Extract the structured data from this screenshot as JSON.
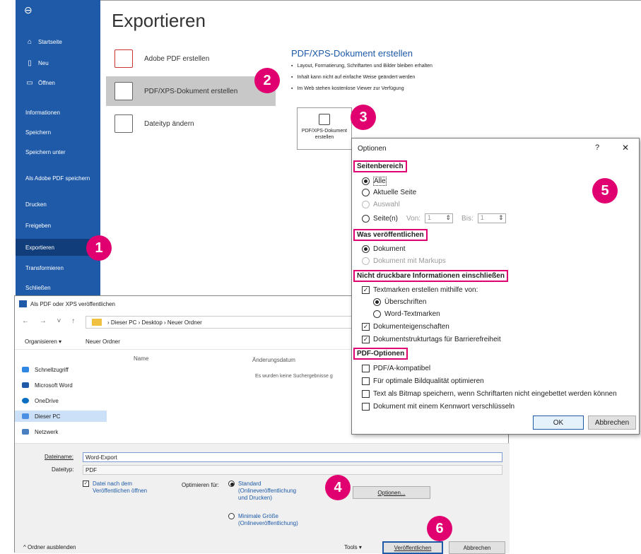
{
  "sidebar": {
    "back": "⊖",
    "items": [
      {
        "label": "Startseite",
        "icon": "home-icon"
      },
      {
        "label": "Neu",
        "icon": "new-document-icon"
      },
      {
        "label": "Öffnen",
        "icon": "open-folder-icon"
      },
      {
        "label": "Informationen"
      },
      {
        "label": "Speichern"
      },
      {
        "label": "Speichern unter"
      },
      {
        "label": "Als Adobe PDF speichern"
      },
      {
        "label": "Drucken"
      },
      {
        "label": "Freigeben"
      },
      {
        "label": "Exportieren"
      },
      {
        "label": "Transformieren"
      },
      {
        "label": "Schließen"
      }
    ]
  },
  "backstage": {
    "title": "Exportieren",
    "items": [
      "Adobe PDF erstellen",
      "PDF/XPS-Dokument erstellen",
      "Dateityp ändern"
    ],
    "pdf_heading": "PDF/XPS-Dokument erstellen",
    "bullets": [
      "Layout, Formatierung, Schriftarten und Bilder bleiben erhalten",
      "Inhalt kann nicht auf einfache Weise geändert werden",
      "Im Web stehen kostenlose Viewer zur Verfügung"
    ],
    "pdf_button": "PDF/XPS-Dokument erstellen"
  },
  "badges": [
    "1",
    "2",
    "3",
    "4",
    "5",
    "6"
  ],
  "save_dialog": {
    "title": "Als PDF oder XPS veröffentlichen",
    "path": "›  Dieser PC  ›  Desktop  ›  Neuer Ordner",
    "organize": "Organisieren ▾",
    "new_folder": "Neuer Ordner",
    "col_name": "Name",
    "col_date": "Änderungsdatum",
    "empty": "Es wurden keine Suchergebnisse g",
    "nav": [
      "Schnellzugriff",
      "Microsoft Word",
      "OneDrive",
      "Dieser PC",
      "Netzwerk"
    ],
    "filename_label": "Dateiname:",
    "filename": "Word-Export",
    "filetype_label": "Dateityp:",
    "filetype": "PDF",
    "open_after": "Datei nach dem Veröffentlichen öffnen",
    "optimize_label": "Optimieren für:",
    "opt_standard": "Standard (Onlineveröffentlichung und Drucken)",
    "opt_min": "Minimale Größe (Onlineveröffentlichung)",
    "options_btn": "Optionen...",
    "hide_folders": "^  Ordner ausblenden",
    "tools": "Tools  ▾",
    "publish": "Veröffentlichen",
    "cancel": "Abbrechen"
  },
  "options": {
    "title": "Optionen",
    "help": "?",
    "close": "✕",
    "sec_range": "Seitenbereich",
    "all": "Alle",
    "current": "Aktuelle Seite",
    "selection": "Auswahl",
    "pages": "Seite(n)",
    "from": "Von:",
    "from_val": "1",
    "to": "Bis:",
    "to_val": "1",
    "sec_publish": "Was veröffentlichen",
    "document": "Dokument",
    "doc_markups": "Dokument mit Markups",
    "sec_nonprint": "Nicht druckbare Informationen einschließen",
    "bookmarks": "Textmarken erstellen mithilfe von:",
    "headings": "Überschriften",
    "word_bookmarks": "Word-Textmarken",
    "doc_props": "Dokumenteigenschaften",
    "struct_tags": "Dokumentstrukturtags für Barrierefreiheit",
    "sec_pdf": "PDF-Optionen",
    "pdfa": "PDF/A-kompatibel",
    "image_quality": "Für optimale Bildqualität optimieren",
    "bitmap": "Text als Bitmap speichern, wenn Schriftarten nicht eingebettet werden können",
    "encrypt": "Dokument mit einem Kennwort verschlüsseln",
    "ok": "OK",
    "cancel": "Abbrechen"
  }
}
